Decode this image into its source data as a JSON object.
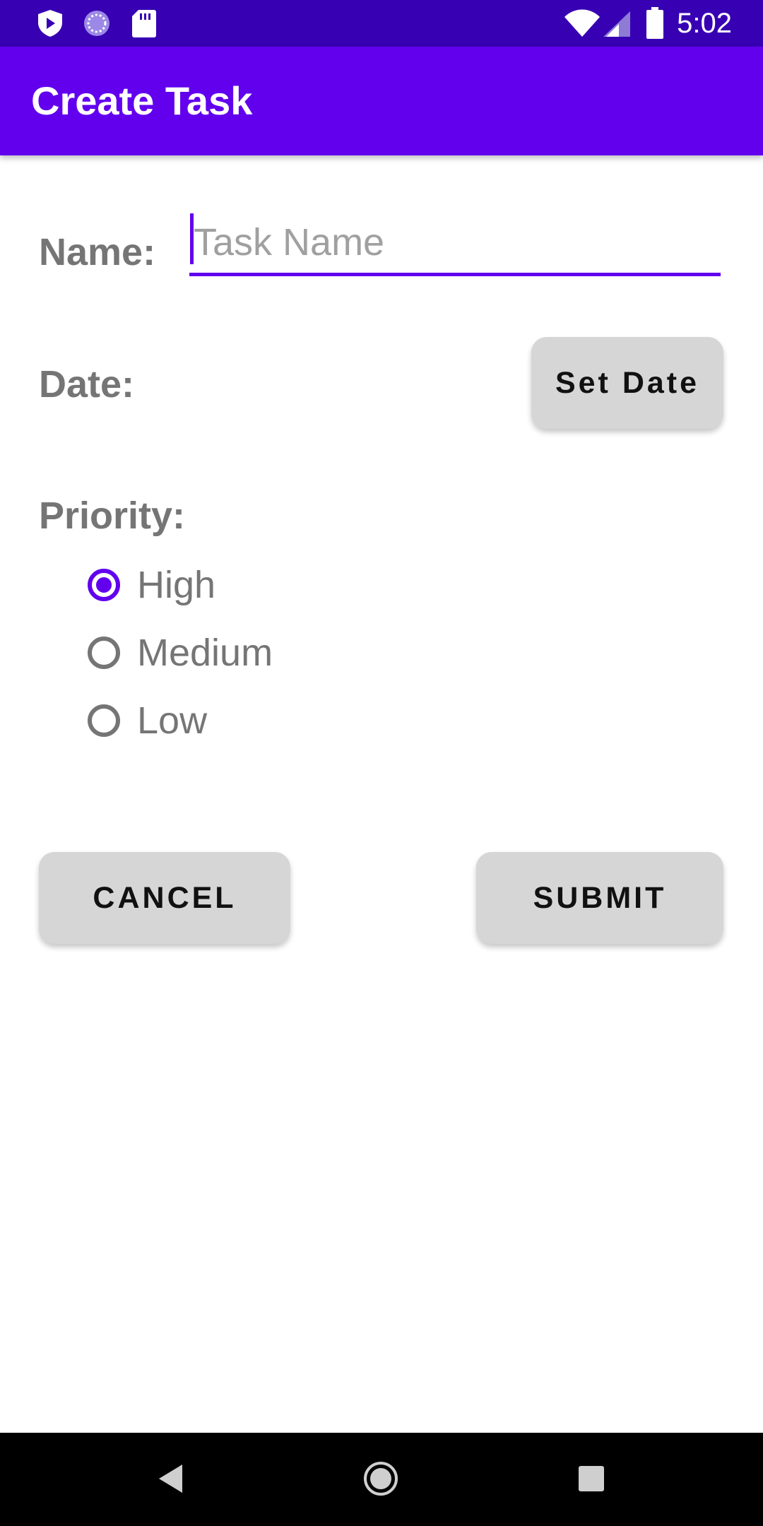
{
  "status_bar": {
    "time": "5:02",
    "left_icons": [
      "play-protect-icon",
      "sync-icon",
      "sd-card-icon"
    ],
    "right_icons": [
      "wifi-icon",
      "signal-icon",
      "battery-icon"
    ]
  },
  "app_bar": {
    "title": "Create Task"
  },
  "form": {
    "name_label": "Name:",
    "name_value": "",
    "name_placeholder": "Task Name",
    "date_label": "Date:",
    "set_date_label": "Set Date",
    "priority_label": "Priority:",
    "priority_options": [
      {
        "label": "High",
        "checked": true
      },
      {
        "label": "Medium",
        "checked": false
      },
      {
        "label": "Low",
        "checked": false
      }
    ],
    "selected_priority": "High",
    "cancel_label": "CANCEL",
    "submit_label": "SUBMIT"
  },
  "nav_bar": {
    "buttons": [
      "back-icon",
      "home-icon",
      "recents-icon"
    ]
  },
  "colors": {
    "status_bar": "#3700b3",
    "app_bar": "#6200ee",
    "accent": "#6200ee",
    "label_gray": "#757575",
    "button_bg": "#d6d6d6"
  }
}
